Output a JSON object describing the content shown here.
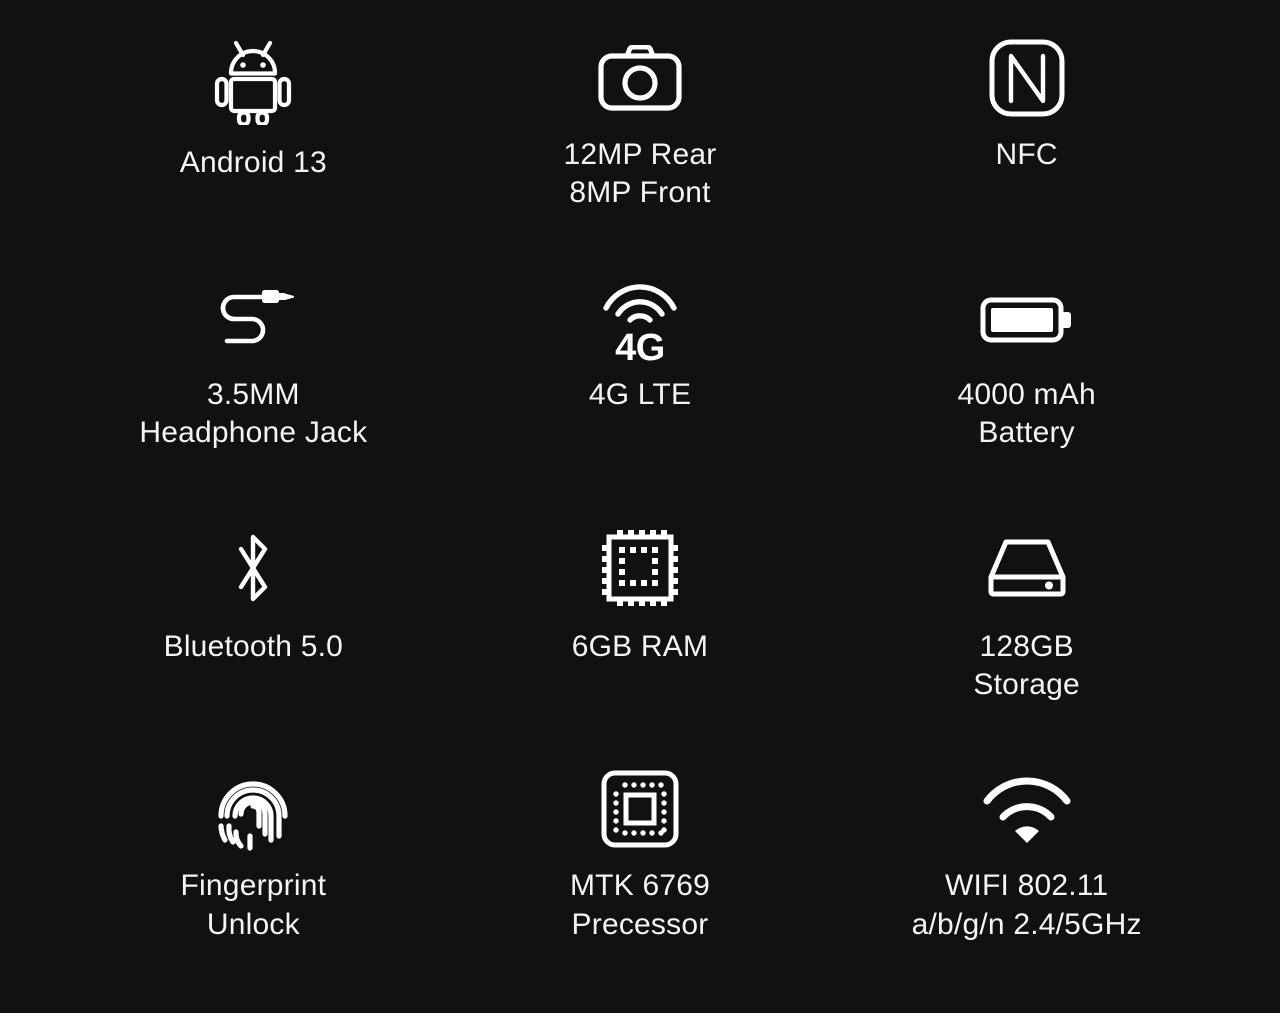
{
  "page": {
    "background_color": "#111111",
    "text_color": "#f4f4f4",
    "title": "Phone Specification Feature Grid"
  },
  "specs": [
    {
      "icon": "android-robot-icon",
      "label": "Android 13"
    },
    {
      "icon": "camera-icon",
      "label": "12MP Rear\n8MP Front"
    },
    {
      "icon": "nfc-icon",
      "label": "NFC"
    },
    {
      "icon": "headphone-jack-icon",
      "label": "3.5MM\nHeadphone Jack"
    },
    {
      "icon": "4g-signal-icon",
      "icon_text": "4G",
      "label": "4G LTE"
    },
    {
      "icon": "battery-icon",
      "label": "4000 mAh\nBattery"
    },
    {
      "icon": "bluetooth-icon",
      "label": "Bluetooth 5.0"
    },
    {
      "icon": "ram-chip-icon",
      "label": "6GB RAM"
    },
    {
      "icon": "storage-drive-icon",
      "label": "128GB\nStorage"
    },
    {
      "icon": "fingerprint-icon",
      "label": "Fingerprint\nUnlock"
    },
    {
      "icon": "processor-chip-icon",
      "label": "MTK 6769\nPrecessor"
    },
    {
      "icon": "wifi-icon",
      "label": "WIFI 802.11\na/b/g/n 2.4/5GHz"
    }
  ]
}
